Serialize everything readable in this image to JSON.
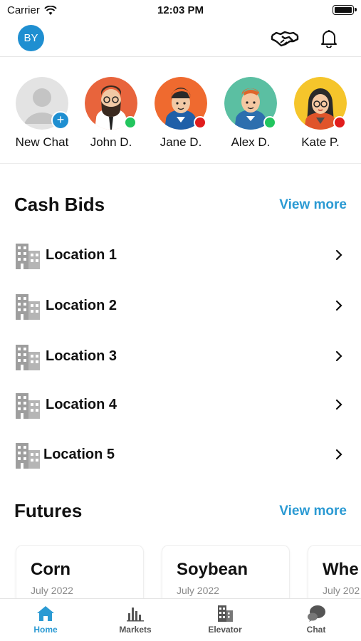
{
  "status_bar": {
    "carrier": "Carrier",
    "time": "12:03 PM"
  },
  "header": {
    "avatar_initials": "BY"
  },
  "stories": [
    {
      "label": "New Chat",
      "type": "new"
    },
    {
      "label": "John D.",
      "status": "online",
      "status_color": "#22c55e",
      "bg": "#e8643c"
    },
    {
      "label": "Jane D.",
      "status": "busy",
      "status_color": "#e11d1d",
      "bg": "#ef6a2f"
    },
    {
      "label": "Alex D.",
      "status": "online",
      "status_color": "#22c55e",
      "bg": "#5bbfa2"
    },
    {
      "label": "Kate P.",
      "status": "busy",
      "status_color": "#e11d1d",
      "bg": "#f5c52b"
    }
  ],
  "cash_bids": {
    "title": "Cash Bids",
    "view_more": "View more",
    "locations": [
      "Location 1",
      "Location 2",
      "Location 3",
      "Location 4",
      "Location 5"
    ]
  },
  "futures": {
    "title": "Futures",
    "view_more": "View more",
    "cards": [
      {
        "name": "Corn",
        "month": "July 2022"
      },
      {
        "name": "Soybean",
        "month": "July 2022"
      },
      {
        "name": "Whe",
        "month": "July 202"
      }
    ]
  },
  "tabbar": {
    "tabs": [
      {
        "label": "Home",
        "icon": "home-icon",
        "active": true
      },
      {
        "label": "Markets",
        "icon": "bar-chart-icon",
        "active": false
      },
      {
        "label": "Elevator",
        "icon": "building-icon",
        "active": false
      },
      {
        "label": "Chat",
        "icon": "chat-bubble-icon",
        "active": false
      }
    ]
  },
  "colors": {
    "accent": "#2b9ad3",
    "avatar_blue": "#1f8fd1",
    "online": "#22c55e",
    "busy": "#e11d1d"
  }
}
